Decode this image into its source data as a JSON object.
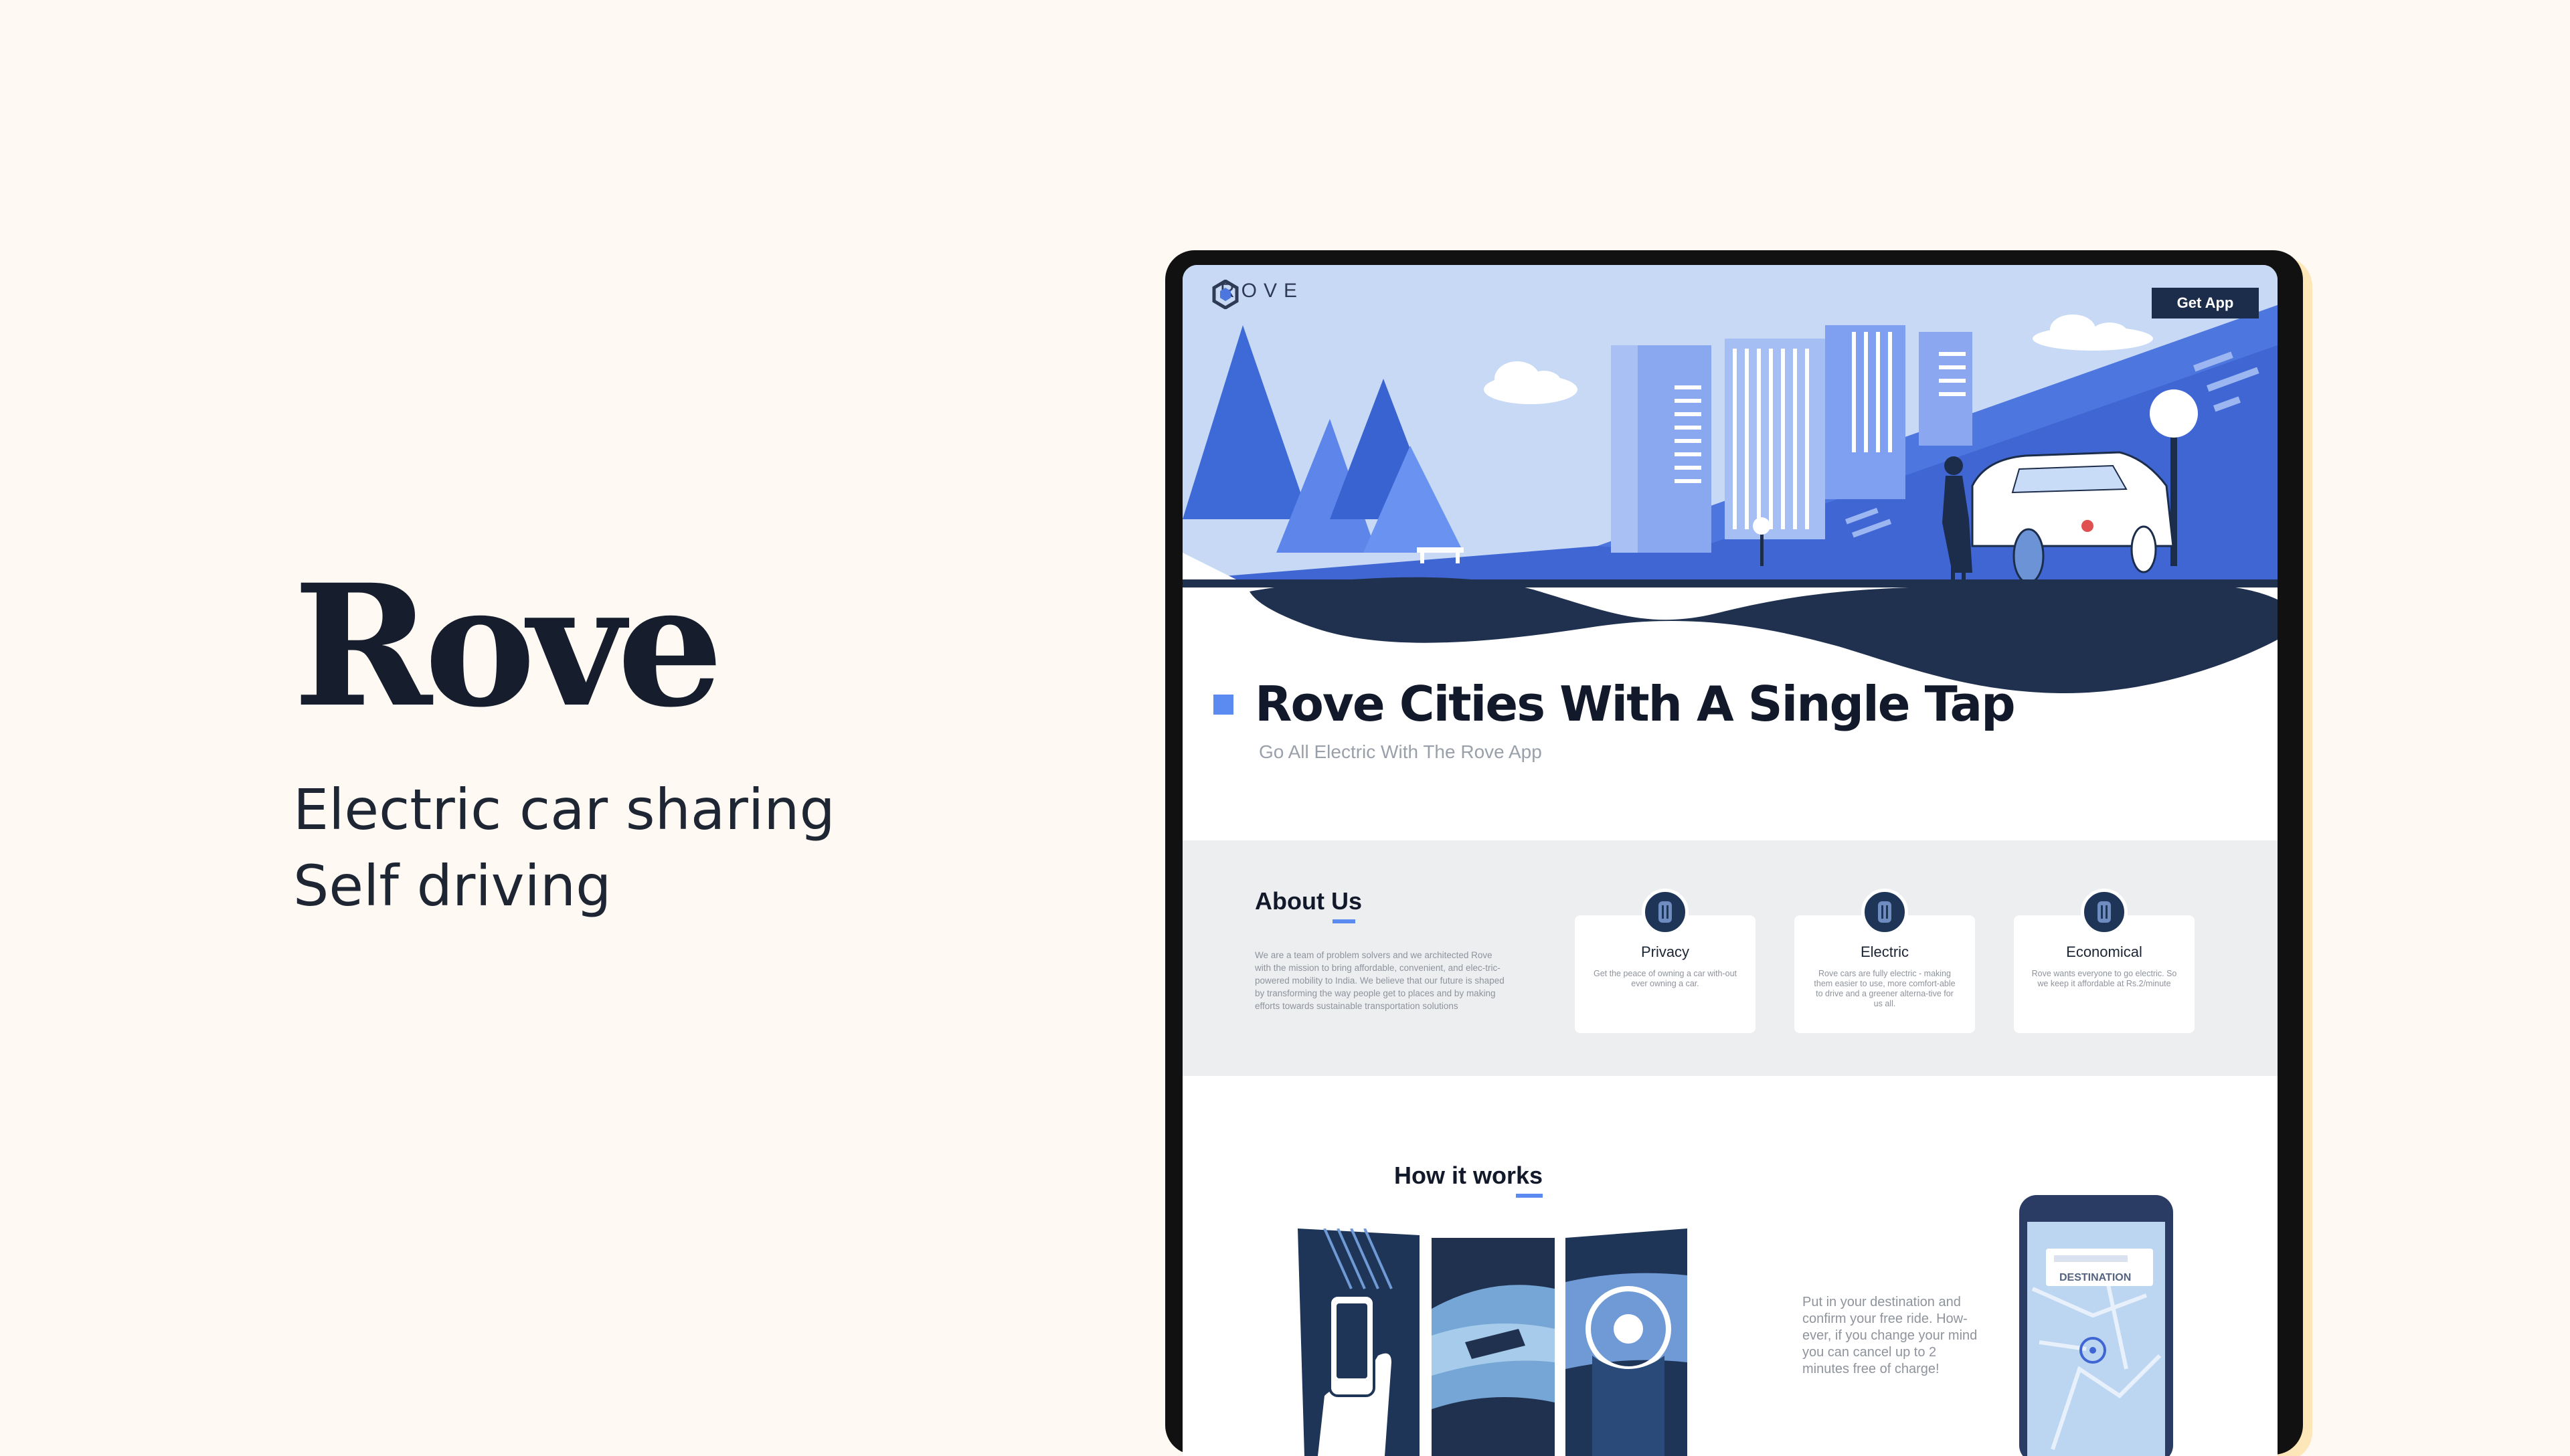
{
  "presentation": {
    "title": "Rove",
    "taglines": [
      "Electric car sharing",
      "Self driving"
    ]
  },
  "site": {
    "logo_text": "ROVE",
    "get_app_label": "Get App",
    "hero": {
      "headline": "Rove Cities With A Single Tap",
      "subheadline": "Go All Electric With The Rove App"
    },
    "about": {
      "title": "About Us",
      "body": "We are a team of problem solvers and we architected Rove with the mission to bring affordable, convenient, and elec-tric-powered mobility to India. We believe that our future is shaped by transforming the way people get to places and by making efforts towards sustainable transportation solutions",
      "cards": [
        {
          "title": "Privacy",
          "text": "Get the peace of owning a car with-out ever owning a car."
        },
        {
          "title": "Electric",
          "text": "Rove cars are fully electric - making them easier to use, more comfort-able to drive and a greener alterna-tive for us all."
        },
        {
          "title": "Economical",
          "text": "Rove wants everyone to go electric. So we keep it affordable at Rs.2/minute"
        }
      ]
    },
    "how_it_works": {
      "title": "How it works",
      "description": "Put in your destination and confirm your free ride. How-ever, if you change your mind you can cancel up to 2 minutes free of charge!",
      "phone_label": "DESTINATION"
    }
  },
  "colors": {
    "background": "#fef9f2",
    "accent": "#5b8af0",
    "navy": "#1c2d4b",
    "hero_sky": "#c5d8f5",
    "hero_blue": "#4a72d9"
  },
  "icons": [
    "logo-hex-icon",
    "car-icon-privacy",
    "car-icon-electric",
    "car-icon-economical"
  ]
}
